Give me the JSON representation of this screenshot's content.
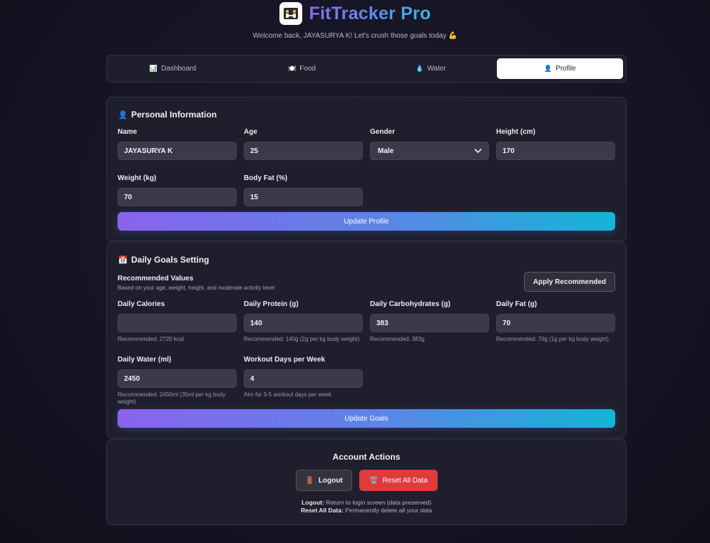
{
  "header": {
    "title": "FitTracker Pro",
    "welcome": "Welcome back, JAYASURYA K! Let's crush those goals today 💪"
  },
  "tabs": [
    {
      "label": "Dashboard",
      "icon": "📊",
      "active": false
    },
    {
      "label": "Food",
      "icon": "🍽️",
      "active": false
    },
    {
      "label": "Water",
      "icon": "💧",
      "active": false
    },
    {
      "label": "Profile",
      "icon": "👤",
      "active": true
    }
  ],
  "personal": {
    "title": "Personal Information",
    "icon": "👤",
    "name_label": "Name",
    "name_value": "JAYASURYA K",
    "age_label": "Age",
    "age_value": "25",
    "gender_label": "Gender",
    "gender_value": "Male",
    "height_label": "Height (cm)",
    "height_value": "170",
    "weight_label": "Weight (kg)",
    "weight_value": "70",
    "bodyfat_label": "Body Fat (%)",
    "bodyfat_value": "15",
    "update_button": "Update Profile"
  },
  "goals": {
    "title": "Daily Goals Setting",
    "icon": "📅",
    "rec_title": "Recommended Values",
    "rec_subtitle": "Based on your age, weight, height, and moderate activity level",
    "apply_button": "Apply Recommended",
    "calories_label": "Daily Calories",
    "calories_value": "",
    "calories_hint": "Recommended: 2720 kcal",
    "protein_label": "Daily Protein (g)",
    "protein_value": "140",
    "protein_hint": "Recommended: 140g (2g per kg body weight)",
    "carbs_label": "Daily Carbohydrates (g)",
    "carbs_value": "383",
    "carbs_hint": "Recommended: 383g",
    "fat_label": "Daily Fat (g)",
    "fat_value": "70",
    "fat_hint": "Recommended: 70g (1g per kg body weight)",
    "water_label": "Daily Water (ml)",
    "water_value": "2450",
    "water_hint": "Recommended: 2450ml (35ml per kg body weight)",
    "workout_label": "Workout Days per Week",
    "workout_value": "4",
    "workout_hint": "Aim for 3-5 workout days per week",
    "update_button": "Update Goals"
  },
  "account": {
    "title": "Account Actions",
    "logout_button": "Logout",
    "logout_icon": "🚪",
    "reset_button": "Reset All Data",
    "reset_icon": "🗑️",
    "logout_note_label": "Logout:",
    "logout_note_text": " Return to login screen (data preserved)",
    "reset_note_label": "Reset All Data:",
    "reset_note_text": " Permanently delete all your data"
  },
  "colors": {
    "accent_start": "#8a63ee",
    "accent_end": "#12b6d6",
    "danger": "#e03a3a",
    "card_bg": "#1e1e2c"
  }
}
